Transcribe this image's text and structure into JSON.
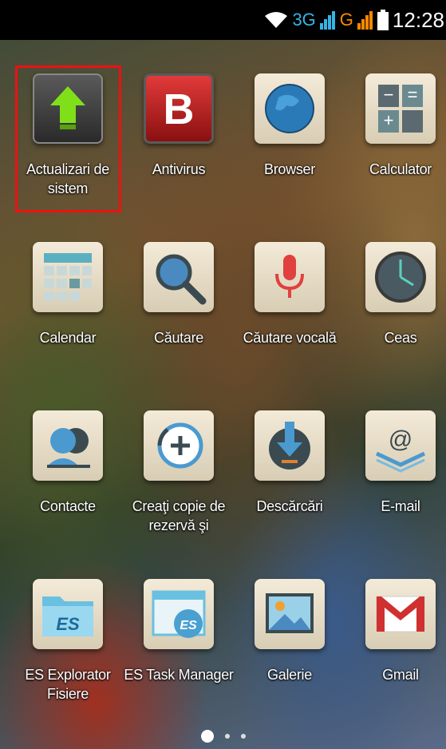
{
  "status_bar": {
    "network1": "3G",
    "network2": "G",
    "time": "12:28"
  },
  "apps": [
    {
      "label": "Actualizari de sistem",
      "icon": "system-update-icon"
    },
    {
      "label": "Antivirus",
      "icon": "antivirus-icon"
    },
    {
      "label": "Browser",
      "icon": "globe-icon"
    },
    {
      "label": "Calculator",
      "icon": "calculator-icon"
    },
    {
      "label": "Calendar",
      "icon": "calendar-icon"
    },
    {
      "label": "Căutare",
      "icon": "search-icon"
    },
    {
      "label": "Căutare vocală",
      "icon": "microphone-icon"
    },
    {
      "label": "Ceas",
      "icon": "clock-icon"
    },
    {
      "label": "Contacte",
      "icon": "contacts-icon"
    },
    {
      "label": "Creaţi copie de rezervă şi",
      "icon": "backup-icon"
    },
    {
      "label": "Descărcări",
      "icon": "download-icon"
    },
    {
      "label": "E-mail",
      "icon": "email-icon"
    },
    {
      "label": "ES Explorator Fisiere",
      "icon": "es-file-explorer-icon"
    },
    {
      "label": "ES Task Manager",
      "icon": "es-task-manager-icon"
    },
    {
      "label": "Galerie",
      "icon": "gallery-icon"
    },
    {
      "label": "Gmail",
      "icon": "gmail-icon"
    }
  ],
  "colors": {
    "highlight": "#ee1111",
    "network_blue": "#33b5e5",
    "network_orange": "#ff8800"
  }
}
